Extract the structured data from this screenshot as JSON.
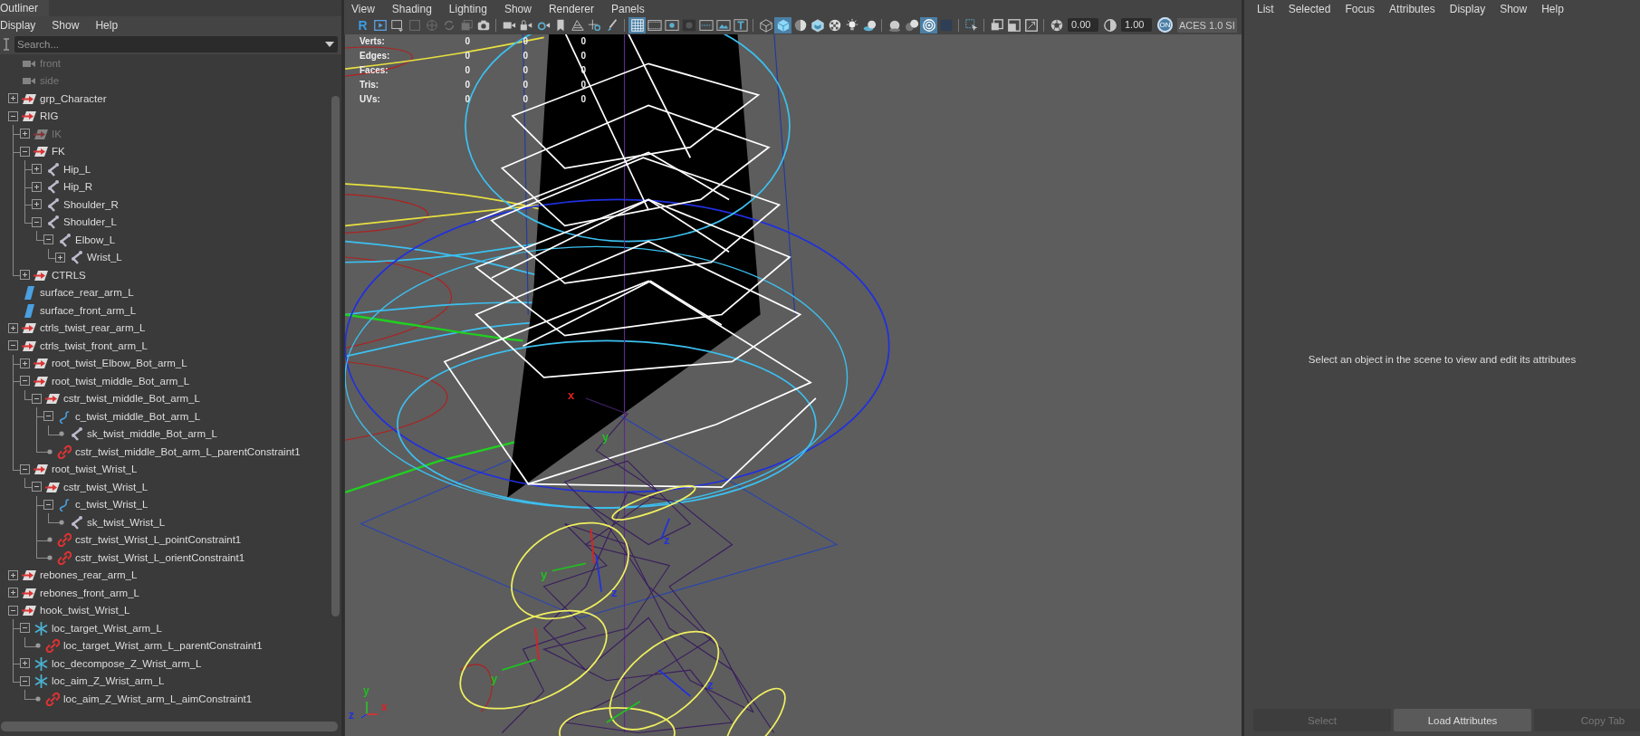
{
  "outliner": {
    "title": "Outliner",
    "menu": [
      "Display",
      "Show",
      "Help"
    ],
    "search": {
      "placeholder": "Search..."
    },
    "items": [
      {
        "label": "front",
        "kind": "camera",
        "hidden": true
      },
      {
        "label": "side",
        "kind": "camera",
        "hidden": true
      },
      {
        "label": "grp_Character",
        "kind": "group",
        "hidden": false,
        "expanded": false
      },
      {
        "label": "RIG",
        "kind": "group",
        "hidden": false,
        "expanded": true,
        "children": [
          {
            "label": "IK",
            "kind": "group",
            "hidden": true,
            "expanded": false
          },
          {
            "label": "FK",
            "kind": "group",
            "hidden": false,
            "expanded": true,
            "children": [
              {
                "label": "Hip_L",
                "kind": "joint",
                "hidden": false,
                "expanded": false
              },
              {
                "label": "Hip_R",
                "kind": "joint",
                "hidden": false,
                "expanded": false
              },
              {
                "label": "Shoulder_R",
                "kind": "joint",
                "hidden": false,
                "expanded": false
              },
              {
                "label": "Shoulder_L",
                "kind": "joint",
                "hidden": false,
                "expanded": true,
                "children": [
                  {
                    "label": "Elbow_L",
                    "kind": "joint",
                    "hidden": false,
                    "expanded": true,
                    "children": [
                      {
                        "label": "Wrist_L",
                        "kind": "joint",
                        "hidden": false,
                        "expanded": false
                      }
                    ]
                  }
                ]
              }
            ]
          },
          {
            "label": "CTRLS",
            "kind": "group",
            "hidden": false,
            "expanded": false
          }
        ]
      },
      {
        "label": "surface_rear_arm_L",
        "kind": "surface",
        "hidden": false
      },
      {
        "label": "surface_front_arm_L",
        "kind": "surface",
        "hidden": false
      },
      {
        "label": "ctrls_twist_rear_arm_L",
        "kind": "group",
        "hidden": false,
        "expanded": false
      },
      {
        "label": "ctrls_twist_front_arm_L",
        "kind": "group",
        "hidden": false,
        "expanded": true,
        "children": [
          {
            "label": "root_twist_Elbow_Bot_arm_L",
            "kind": "group",
            "hidden": false,
            "expanded": false
          },
          {
            "label": "root_twist_middle_Bot_arm_L",
            "kind": "group",
            "hidden": false,
            "expanded": true,
            "children": [
              {
                "label": "cstr_twist_middle_Bot_arm_L",
                "kind": "group",
                "hidden": false,
                "expanded": true,
                "children": [
                  {
                    "label": "c_twist_middle_Bot_arm_L",
                    "kind": "curve",
                    "hidden": false,
                    "expanded": true,
                    "children": [
                      {
                        "label": "sk_twist_middle_Bot_arm_L",
                        "kind": "joint",
                        "hidden": false
                      }
                    ]
                  },
                  {
                    "label": "cstr_twist_middle_Bot_arm_L_parentConstraint1",
                    "kind": "constraint",
                    "hidden": false
                  }
                ]
              }
            ]
          },
          {
            "label": "root_twist_Wrist_L",
            "kind": "group",
            "hidden": false,
            "expanded": true,
            "children": [
              {
                "label": "cstr_twist_Wrist_L",
                "kind": "group",
                "hidden": false,
                "expanded": true,
                "children": [
                  {
                    "label": "c_twist_Wrist_L",
                    "kind": "curve",
                    "hidden": false,
                    "expanded": true,
                    "children": [
                      {
                        "label": "sk_twist_Wrist_L",
                        "kind": "joint",
                        "hidden": false
                      }
                    ]
                  },
                  {
                    "label": "cstr_twist_Wrist_L_pointConstraint1",
                    "kind": "constraint",
                    "hidden": false
                  },
                  {
                    "label": "cstr_twist_Wrist_L_orientConstraint1",
                    "kind": "constraint",
                    "hidden": false
                  }
                ]
              }
            ]
          }
        ]
      },
      {
        "label": "rebones_rear_arm_L",
        "kind": "group",
        "hidden": false,
        "expanded": false
      },
      {
        "label": "rebones_front_arm_L",
        "kind": "group",
        "hidden": false,
        "expanded": false
      },
      {
        "label": "hook_twist_Wrist_L",
        "kind": "group",
        "hidden": false,
        "expanded": true,
        "children": [
          {
            "label": "loc_target_Wrist_arm_L",
            "kind": "locator",
            "hidden": false,
            "expanded": true,
            "children": [
              {
                "label": "loc_target_Wrist_arm_L_parentConstraint1",
                "kind": "constraint",
                "hidden": false
              }
            ]
          },
          {
            "label": "loc_decompose_Z_Wrist_arm_L",
            "kind": "locator",
            "hidden": false,
            "expanded": false
          },
          {
            "label": "loc_aim_Z_Wrist_arm_L",
            "kind": "locator",
            "hidden": false,
            "expanded": true,
            "children": [
              {
                "label": "loc_aim_Z_Wrist_arm_L_aimConstraint1",
                "kind": "constraint",
                "hidden": false
              }
            ]
          }
        ]
      }
    ]
  },
  "viewport": {
    "menu": [
      "View",
      "Shading",
      "Lighting",
      "Show",
      "Renderer",
      "Panels"
    ],
    "toolbar": [
      {
        "kind": "glyph",
        "text": "R"
      },
      {
        "kind": "icon",
        "selected": false,
        "disabled": false
      },
      {
        "kind": "icon",
        "selected": false,
        "disabled": false
      },
      {
        "kind": "icon",
        "selected": false,
        "disabled": true
      },
      {
        "kind": "icon",
        "selected": false,
        "disabled": true
      },
      {
        "kind": "icon",
        "selected": false,
        "disabled": true
      },
      {
        "kind": "icon",
        "selected": false,
        "disabled": true
      },
      {
        "kind": "icon",
        "selected": false,
        "disabled": false
      },
      {
        "kind": "separator"
      },
      {
        "kind": "icon",
        "selected": false,
        "disabled": false
      },
      {
        "kind": "icon",
        "selected": false,
        "disabled": false
      },
      {
        "kind": "icon",
        "selected": false,
        "disabled": false
      },
      {
        "kind": "icon",
        "selected": false,
        "disabled": false
      },
      {
        "kind": "icon",
        "selected": false,
        "disabled": false
      },
      {
        "kind": "icon",
        "selected": false,
        "disabled": false
      },
      {
        "kind": "icon",
        "selected": false,
        "disabled": false
      },
      {
        "kind": "separator"
      },
      {
        "kind": "icon",
        "selected": true,
        "disabled": false
      },
      {
        "kind": "icon",
        "selected": false,
        "disabled": false
      },
      {
        "kind": "icon",
        "selected": false,
        "disabled": false
      },
      {
        "kind": "icon",
        "selected": false,
        "disabled": false
      },
      {
        "kind": "icon",
        "selected": false,
        "disabled": false
      },
      {
        "kind": "icon",
        "selected": false,
        "disabled": false
      },
      {
        "kind": "icon",
        "selected": false,
        "disabled": false
      },
      {
        "kind": "separator"
      },
      {
        "kind": "icon",
        "selected": false,
        "disabled": false
      },
      {
        "kind": "icon",
        "selected": true,
        "disabled": false
      },
      {
        "kind": "icon",
        "selected": false,
        "disabled": false
      },
      {
        "kind": "icon",
        "selected": false,
        "disabled": false
      },
      {
        "kind": "icon",
        "selected": false,
        "disabled": false
      },
      {
        "kind": "icon",
        "selected": false,
        "disabled": false
      },
      {
        "kind": "icon",
        "selected": false,
        "disabled": false
      },
      {
        "kind": "separator"
      },
      {
        "kind": "icon",
        "selected": false,
        "disabled": false
      },
      {
        "kind": "icon",
        "selected": false,
        "disabled": false
      },
      {
        "kind": "icon",
        "selected": true,
        "disabled": false
      },
      {
        "kind": "icon",
        "selected": false,
        "disabled": false
      },
      {
        "kind": "separator"
      },
      {
        "kind": "icon",
        "selected": false,
        "disabled": false
      },
      {
        "kind": "separator"
      },
      {
        "kind": "icon",
        "selected": false,
        "disabled": false
      },
      {
        "kind": "icon",
        "selected": false,
        "disabled": false
      },
      {
        "kind": "icon",
        "selected": false,
        "disabled": false
      },
      {
        "kind": "separator"
      },
      {
        "kind": "icon",
        "selected": false,
        "disabled": false
      },
      {
        "kind": "field",
        "value": "0.00"
      },
      {
        "kind": "icon",
        "selected": false,
        "disabled": false
      },
      {
        "kind": "field",
        "value": "1.00"
      },
      {
        "kind": "badge",
        "text": "ON"
      },
      {
        "kind": "label",
        "text": "ACES 1.0 SI"
      }
    ],
    "hud": [
      {
        "label": "Verts:",
        "values": [
          "0",
          "0",
          "0"
        ]
      },
      {
        "label": "Edges:",
        "values": [
          "0",
          "0",
          "0"
        ]
      },
      {
        "label": "Faces:",
        "values": [
          "0",
          "0",
          "0"
        ]
      },
      {
        "label": "Tris:",
        "values": [
          "0",
          "0",
          "0"
        ]
      },
      {
        "label": "UVs:",
        "values": [
          "0",
          "0",
          "0"
        ]
      }
    ],
    "scene_labels": [
      {
        "text": "x",
        "color": "#e02020"
      },
      {
        "text": "y",
        "color": "#20c020"
      },
      {
        "text": "z",
        "color": "#2030e0"
      },
      {
        "text": "y",
        "color": "#20c020"
      },
      {
        "text": "z",
        "color": "#2030e0"
      },
      {
        "text": "y",
        "color": "#20c020"
      },
      {
        "text": "z",
        "color": "#2030e0"
      }
    ],
    "axis_labels": [
      {
        "text": "y",
        "color": "#20c020"
      },
      {
        "text": "z",
        "color": "#2030e0"
      },
      {
        "text": "x",
        "color": "#e02020"
      }
    ]
  },
  "attribute_editor": {
    "menu": [
      "List",
      "Selected",
      "Focus",
      "Attributes",
      "Display",
      "Show",
      "Help"
    ],
    "message": "Select an object in the scene to view and edit its attributes",
    "buttons": [
      {
        "label": "Select",
        "disabled": true
      },
      {
        "label": "Load Attributes",
        "disabled": false
      },
      {
        "label": "Copy Tab",
        "disabled": true
      }
    ]
  }
}
